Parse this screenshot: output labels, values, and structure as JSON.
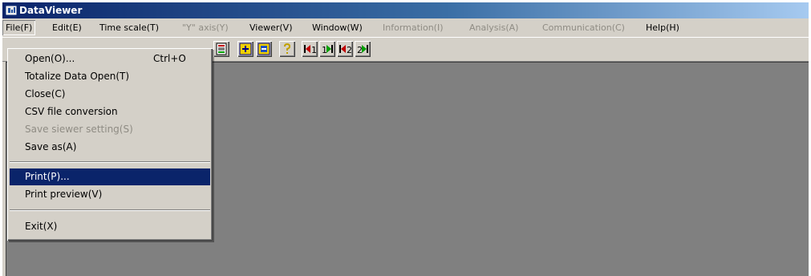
{
  "app": {
    "title": "DataViewer",
    "icon": "dataviewer-app-icon"
  },
  "menubar": [
    {
      "label": "File(F)",
      "disabled": false,
      "active": true
    },
    {
      "label": "Edit(E)",
      "disabled": false
    },
    {
      "label": "Time scale(T)",
      "disabled": false
    },
    {
      "label": "\"Y\" axis(Y)",
      "disabled": true
    },
    {
      "label": "Viewer(V)",
      "disabled": false
    },
    {
      "label": "Window(W)",
      "disabled": false
    },
    {
      "label": "Information(I)",
      "disabled": true
    },
    {
      "label": "Analysis(A)",
      "disabled": true
    },
    {
      "label": "Communication(C)",
      "disabled": true
    },
    {
      "label": "Help(H)",
      "disabled": false
    }
  ],
  "file_menu": {
    "items": [
      {
        "label": "Open(O)...",
        "shortcut": "Ctrl+O"
      },
      {
        "label": "Totalize Data Open(T)"
      },
      {
        "label": "Close(C)"
      },
      {
        "label": "CSV file conversion"
      },
      {
        "label": "Save siewer setting(S)",
        "disabled": true
      },
      {
        "label": "Save as(A)"
      },
      {
        "label": "Print(P)...",
        "selected": true
      },
      {
        "label": "Print preview(V)"
      },
      {
        "label": "Exit(X)"
      }
    ]
  },
  "toolbar": {
    "buttons": [
      {
        "icon": "record-icon"
      },
      {
        "icon": "move-yellow-icon"
      },
      {
        "icon": "swap-yellow-icon"
      },
      {
        "icon": "help-question-icon"
      },
      {
        "icon": "jump-left-1-icon",
        "text": "1"
      },
      {
        "icon": "jump-right-1-icon",
        "text": "1"
      },
      {
        "icon": "jump-left-2-icon",
        "text": "2"
      },
      {
        "icon": "jump-right-2-icon",
        "text": "2"
      }
    ]
  },
  "colors": {
    "title_bar_start": "#0a246a",
    "title_bar_end": "#a6caf0",
    "menu_selection": "#0a246a",
    "workspace": "#808080",
    "face": "#d4d0c8"
  }
}
